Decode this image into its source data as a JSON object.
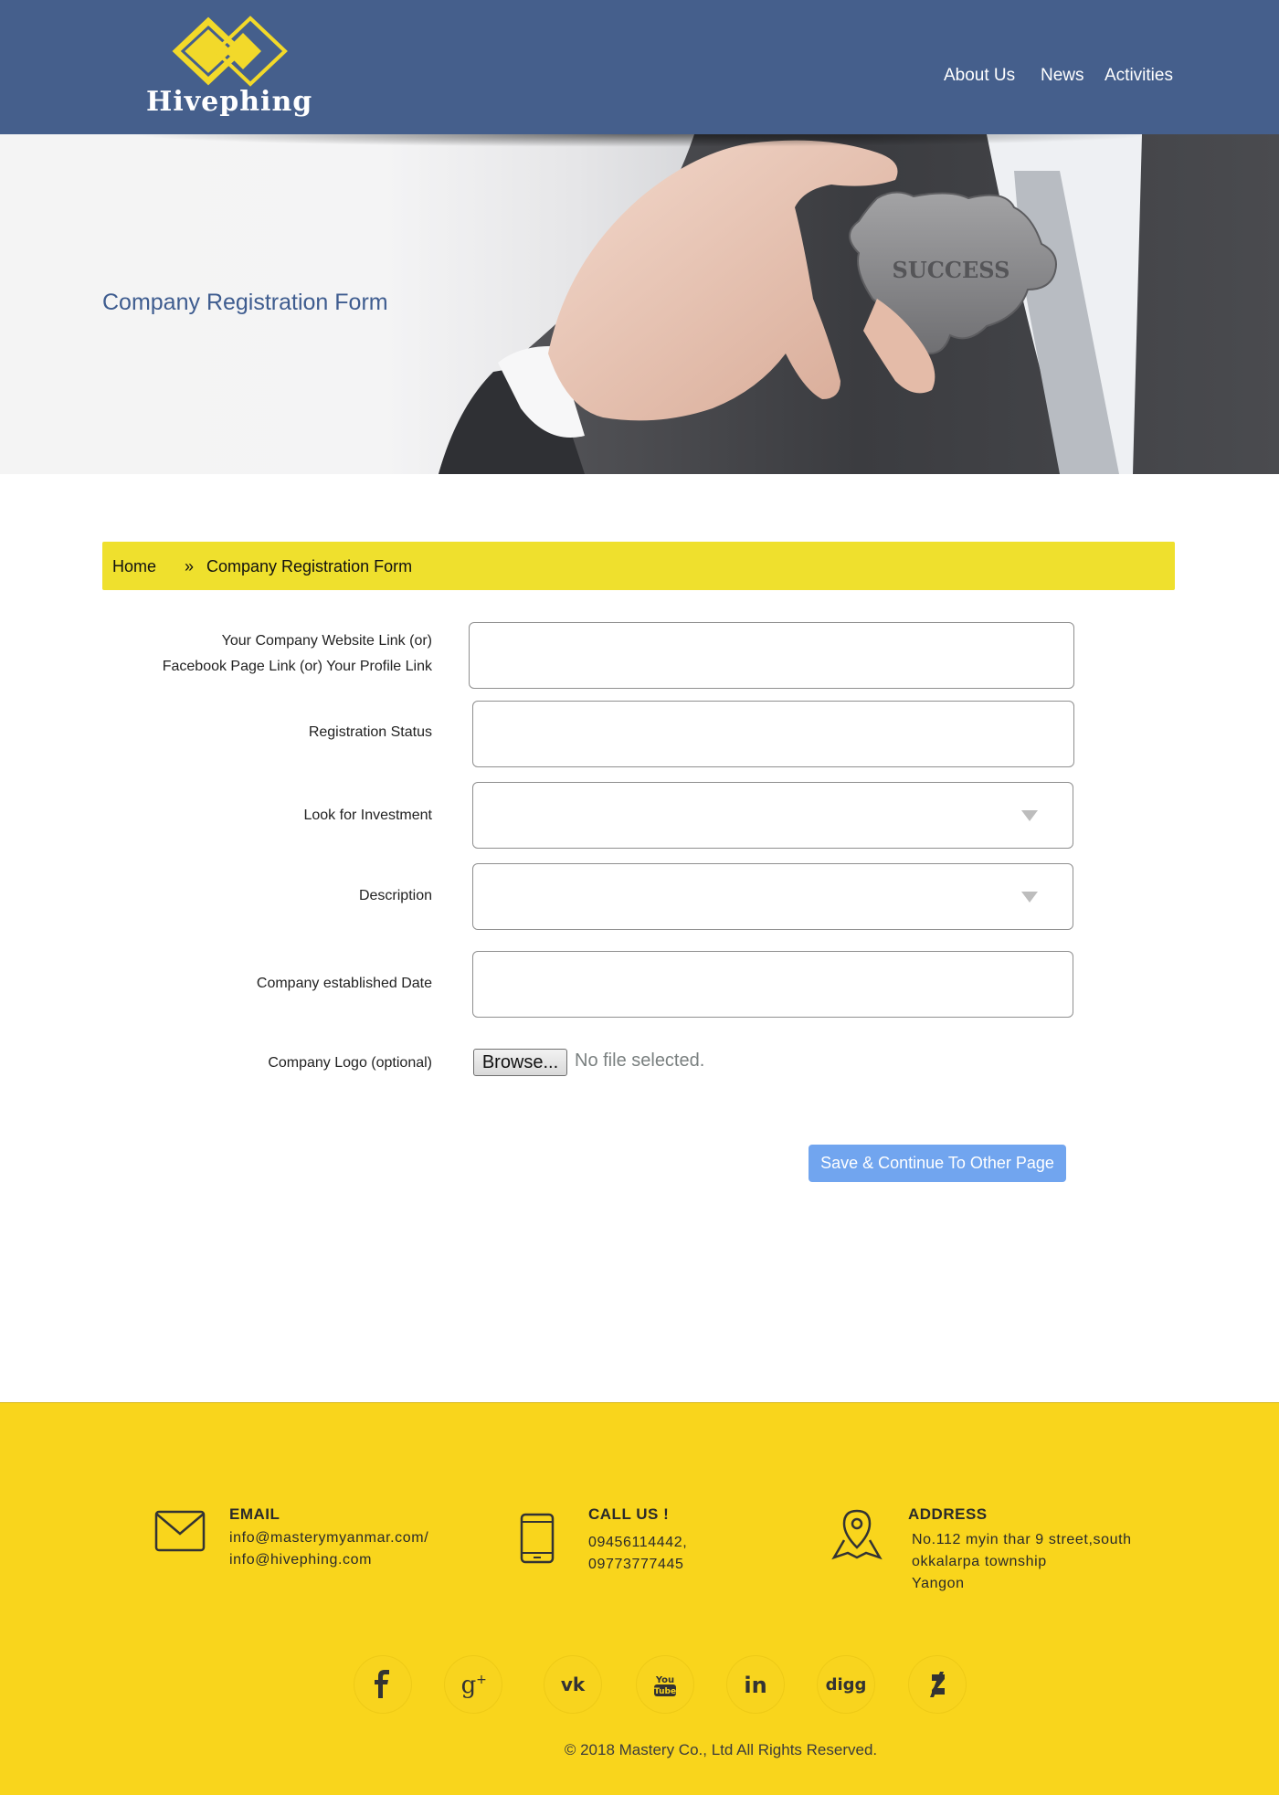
{
  "header": {
    "logo_text": "Hivephing",
    "nav": [
      {
        "label": "About Us"
      },
      {
        "label": "News"
      },
      {
        "label": "Activities"
      }
    ]
  },
  "hero": {
    "title": "Company Registration Form",
    "puzzle_text": "SUCCESS"
  },
  "breadcrumb": {
    "home": "Home",
    "separator": "»",
    "current": "Company Registration Form"
  },
  "form": {
    "website_label_line1": "Your Company Website Link (or)",
    "website_label_line2": "Facebook Page Link  (or)  Your Profile Link",
    "website_value": "",
    "registration_status_label": "Registration Status",
    "registration_status_value": "",
    "investment_label": "Look for Investment",
    "investment_selected": "",
    "description_label": "Description",
    "description_selected": "",
    "established_date_label": "Company established Date",
    "established_date_value": "",
    "logo_label": "Company Logo (optional)",
    "browse_label": "Browse...",
    "file_status": "No file selected.",
    "save_button": "Save & Continue To Other Page"
  },
  "footer": {
    "email": {
      "heading": "EMAIL",
      "line1": "info@masterymyanmar.com/",
      "line2": "info@hivephing.com"
    },
    "call": {
      "heading": "CALL US !",
      "line1": "09456114442,",
      "line2": "09773777445"
    },
    "address": {
      "heading": "ADDRESS",
      "line1": "No.112 myin thar 9 street,south",
      "line2": "okkalarpa township",
      "line3": "Yangon"
    },
    "social": [
      "facebook-icon",
      "google-plus-icon",
      "vk-icon",
      "youtube-icon",
      "linkedin-icon",
      "digg-icon",
      "deviantart-icon"
    ],
    "copyright": "© 2018 Mastery Co., Ltd All Rights Reserved."
  },
  "colors": {
    "header_bg": "#455f8c",
    "accent_yellow": "#efe02d",
    "footer_bg": "#f9d51c",
    "button_blue": "#71a5ef",
    "title_blue": "#3e5c8f"
  }
}
